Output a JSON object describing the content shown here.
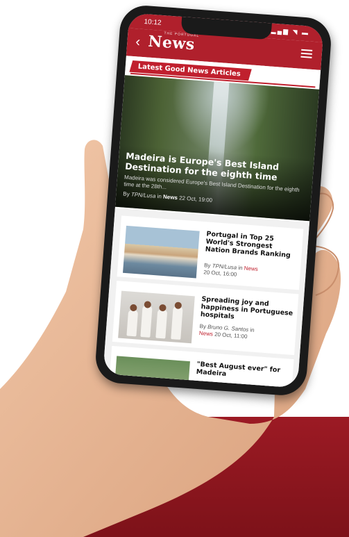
{
  "status": {
    "time": "10:12",
    "icons": "▂▄▆ ◥ ▬"
  },
  "appbar": {
    "logo": "News",
    "logo_small": "THE PORTUGAL",
    "back": "‹"
  },
  "section": {
    "label": "Latest Good News Articles"
  },
  "hero": {
    "title": "Madeira is Europe's Best Island Destination for the eighth time",
    "excerpt": "Madeira was considered Europe's Best Island Destination for the eighth time at the 28th...",
    "by_prefix": "By",
    "author": "TPN/Lusa",
    "in": "in",
    "category": "News",
    "date": "22 Oct, 19:00"
  },
  "articles": [
    {
      "title": "Portugal in Top 25 World's Strongest Nation Brands Ranking",
      "by_prefix": "By",
      "author": "TPN/Lusa",
      "in": "in",
      "category": "News",
      "date": "20 Oct, 16:00"
    },
    {
      "title": "Spreading joy and happiness in Portuguese hospitals",
      "by_prefix": "By",
      "author": "Bruno G. Santos",
      "in": "in",
      "category": "News",
      "date": "20 Oct, 11:00"
    },
    {
      "title": "\"Best August ever\" for Madeira",
      "by_prefix": "",
      "author": "",
      "in": "",
      "category": "",
      "date": ""
    }
  ],
  "colors": {
    "brand_red": "#b0202c",
    "background_red": "#8a1720"
  }
}
